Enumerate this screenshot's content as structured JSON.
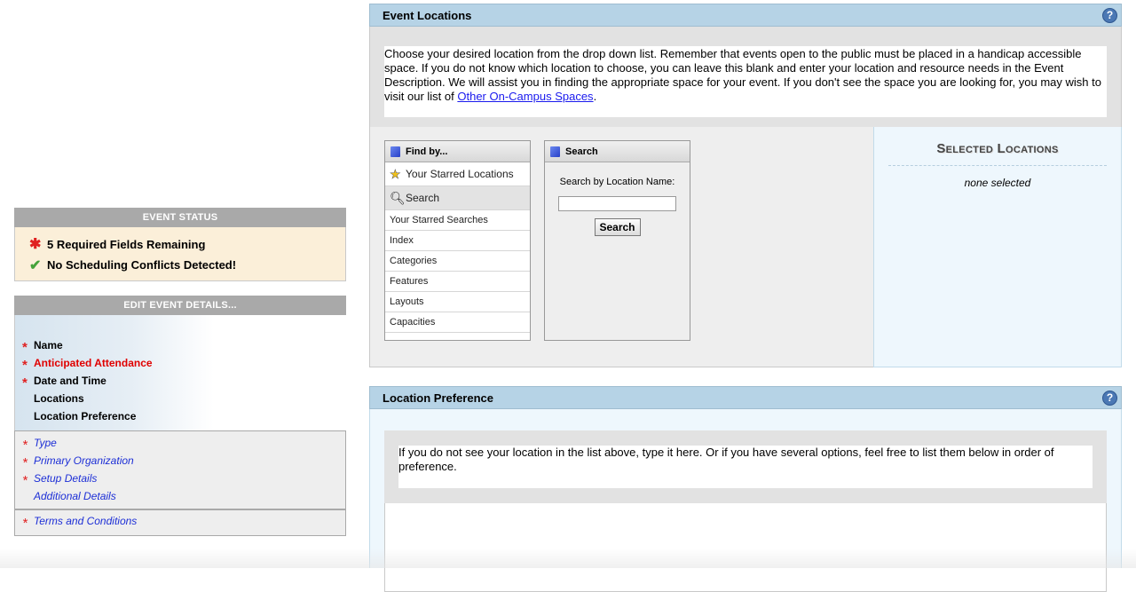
{
  "event_status": {
    "heading": "EVENT STATUS",
    "required": "5 Required Fields Remaining",
    "conflicts": "No Scheduling Conflicts Detected!"
  },
  "edit_details": {
    "heading": "EDIT EVENT DETAILS...",
    "group1": [
      {
        "label": "Name",
        "required": true
      },
      {
        "label": "Anticipated Attendance",
        "required": true
      },
      {
        "label": "Date and Time",
        "required": true
      },
      {
        "label": "Locations",
        "required": false
      },
      {
        "label": "Location Preference",
        "required": false
      }
    ],
    "group2": [
      {
        "label": "Type",
        "required": true
      },
      {
        "label": "Primary Organization",
        "required": true
      },
      {
        "label": "Setup Details",
        "required": true
      },
      {
        "label": "Additional Details",
        "required": false
      }
    ],
    "group3": [
      {
        "label": "Terms and Conditions",
        "required": true
      }
    ]
  },
  "event_locations": {
    "title": "Event Locations",
    "help": "?",
    "intro": "Choose your desired location from the drop down list. Remember that events open to the public must be placed in a handicap accessible space. If you do not know which location to choose, you can leave this blank and enter your location and resource needs in the Event Description. We will assist you in finding the appropriate space for your event. If you don't see the space you are looking for, you may wish to visit our list of",
    "intro_link": "Other On-Campus Spaces",
    "intro_end": "."
  },
  "find_by": {
    "heading": "Find by...",
    "items": [
      "Your Starred Locations",
      "Search",
      "Your Starred Searches",
      "Index",
      "Categories",
      "Features",
      "Layouts",
      "Capacities"
    ]
  },
  "search": {
    "heading": "Search",
    "label": "Search by Location Name:",
    "value": "",
    "button": "Search"
  },
  "selected_locations": {
    "title": "Selected Locations",
    "empty": "none selected"
  },
  "location_preference": {
    "title": "Location Preference",
    "help": "?",
    "intro": "If you do not see your location in the list above, type it here. Or if you have several options, feel free to list them below in order of preference.",
    "value": ""
  },
  "colors": {
    "section_header": "#b6d3e6",
    "required_red": "#e02020",
    "link_blue": "#1d2fd6",
    "status_bg": "#fbefd9"
  }
}
